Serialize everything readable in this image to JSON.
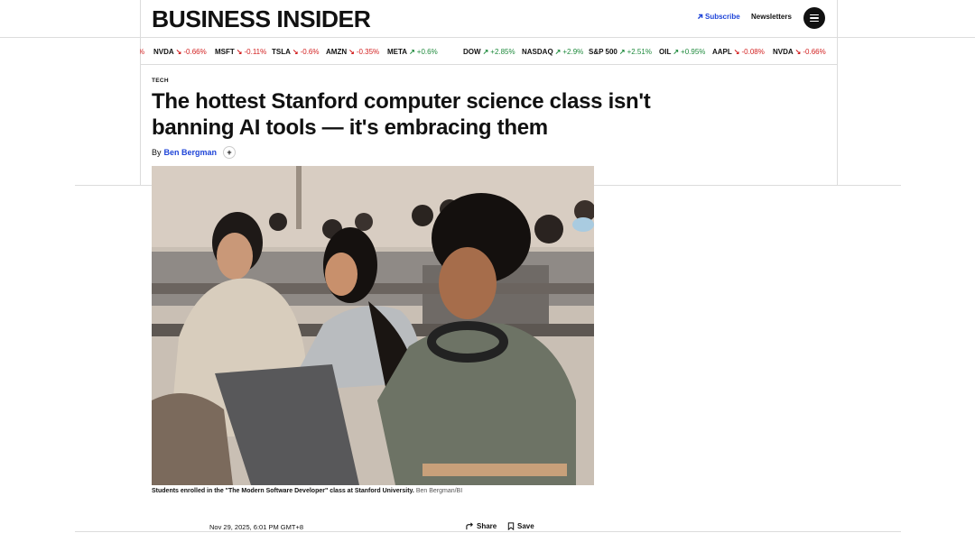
{
  "header": {
    "logo_text": "BUSINESS INSIDER",
    "subscribe_label": "Subscribe",
    "newsletters_label": "Newsletters",
    "brand_color": "#1f45d8"
  },
  "ticker": [
    {
      "symbol": "",
      "change": "%",
      "direction": "down"
    },
    {
      "symbol": "NVDA",
      "change": "-0.66%",
      "direction": "down"
    },
    {
      "symbol": "MSFT",
      "change": "-0.11%",
      "direction": "down"
    },
    {
      "symbol": "TSLA",
      "change": "-0.6%",
      "direction": "down"
    },
    {
      "symbol": "AMZN",
      "change": "-0.35%",
      "direction": "down"
    },
    {
      "symbol": "META",
      "change": "+0.6%",
      "direction": "up"
    },
    {
      "symbol": "DOW",
      "change": "+2.85%",
      "direction": "up"
    },
    {
      "symbol": "NASDAQ",
      "change": "+2.9%",
      "direction": "up"
    },
    {
      "symbol": "S&P 500",
      "change": "+2.51%",
      "direction": "up"
    },
    {
      "symbol": "OIL",
      "change": "+0.95%",
      "direction": "up"
    },
    {
      "symbol": "AAPL",
      "change": "-0.08%",
      "direction": "down"
    },
    {
      "symbol": "NVDA",
      "change": "-0.66%",
      "direction": "down"
    }
  ],
  "article": {
    "category": "TECH",
    "headline": "The hottest Stanford computer science class isn't banning AI tools — it's embracing them",
    "by_prefix": "By",
    "author": "Ben Bergman",
    "follow_symbol": "+",
    "caption": "Students enrolled in the \"The Modern Software Developer\" class at Stanford University.",
    "caption_credit": "Ben Bergman/BI",
    "timestamp": "Nov 29, 2025, 6:01 PM GMT+8",
    "share_label": "Share",
    "save_label": "Save"
  },
  "colors": {
    "down": "#d21f1f",
    "up": "#1e8a3c"
  }
}
